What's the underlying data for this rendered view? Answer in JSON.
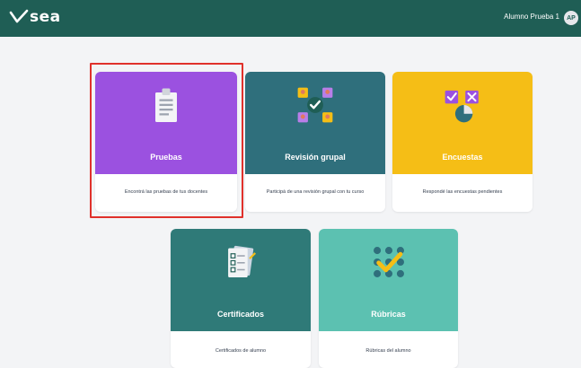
{
  "header": {
    "app_name": "sea",
    "user_name": "Alumno Prueba 1",
    "avatar_initials": "AP",
    "logo_icon": "check-logo-icon",
    "bg_color": "#1f5e55"
  },
  "cards": [
    {
      "title": "Pruebas",
      "description": "Encontrá las pruebas de tus docentes",
      "icon": "clipboard-icon",
      "color": "#9b51e0",
      "selected": true
    },
    {
      "title": "Revisión grupal",
      "description": "Participá de una revisión grupal con tu curso",
      "icon": "group-review-icon",
      "color": "#2f6f7c"
    },
    {
      "title": "Encuestas",
      "description": "Respondé las encuestas pendientes",
      "icon": "survey-icon",
      "color": "#f5be16"
    },
    {
      "title": "Certificados",
      "description": "Certificados de alumno",
      "icon": "certificate-icon",
      "color": "#2f7a78"
    },
    {
      "title": "Rúbricas",
      "description": "Rúbricas del alumno",
      "icon": "rubric-icon",
      "color": "#5cc1b1"
    }
  ]
}
